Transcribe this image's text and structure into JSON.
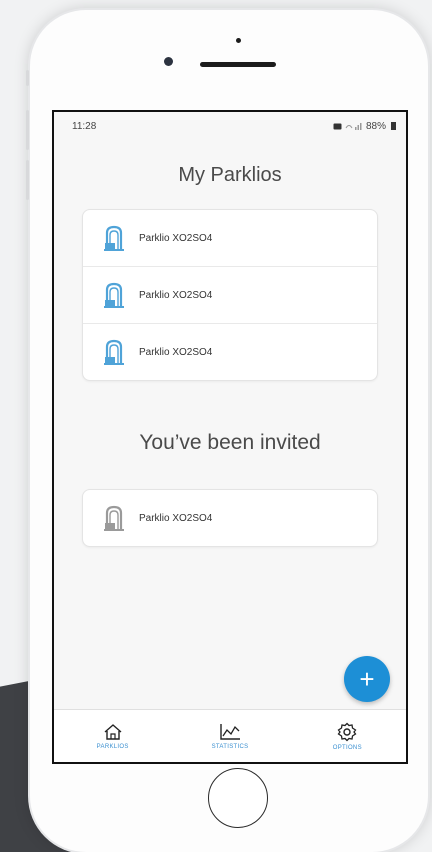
{
  "status_bar": {
    "time": "11:28",
    "indicators": "88%"
  },
  "my_parklios": {
    "title": "My Parklios",
    "items": [
      {
        "label": "Parklio XO2SO4",
        "icon": "parking-barrier-icon"
      },
      {
        "label": "Parklio XO2SO4",
        "icon": "parking-barrier-icon"
      },
      {
        "label": "Parklio XO2SO4",
        "icon": "parking-barrier-icon"
      }
    ]
  },
  "invited": {
    "title": "You’ve been invited",
    "items": [
      {
        "label": "Parklio XO2SO4",
        "icon": "parking-barrier-icon"
      }
    ]
  },
  "fab": {
    "label": "+"
  },
  "nav": [
    {
      "label": "PARKLIOS",
      "icon": "home-icon"
    },
    {
      "label": "STATISTICS",
      "icon": "chart-icon"
    },
    {
      "label": "OPTIONS",
      "icon": "gear-icon"
    }
  ],
  "colors": {
    "accent": "#1d8fd6",
    "icon_active": "#4fa3d8",
    "icon_inactive": "#9a9a9a"
  }
}
